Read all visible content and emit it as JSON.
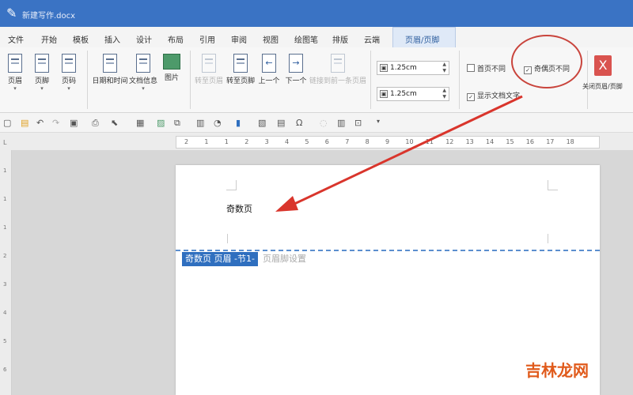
{
  "window": {
    "title": "新建写作.docx",
    "icon": "pen-icon"
  },
  "menu": {
    "items": [
      "文件",
      "开始",
      "模板",
      "插入",
      "设计",
      "布局",
      "引用",
      "审阅",
      "视图",
      "绘图笔",
      "排版",
      "云端",
      "页眉/页脚"
    ],
    "active": "页眉/页脚"
  },
  "ribbon": {
    "header": "页眉",
    "footer": "页脚",
    "page_number": "页码",
    "date_time": "日期和时间",
    "doc_info": "文档信息",
    "picture": "图片",
    "goto_header": "转至页眉",
    "goto_footer": "转至页脚",
    "prev": "上一个",
    "next": "下一个",
    "link_prev": "链接到前一条页眉",
    "header_distance": "1.25cm",
    "footer_distance": "1.25cm",
    "first_page_diff": "首页不同",
    "odd_even_diff": "奇偶页不同",
    "show_doc_text": "显示文档文字",
    "close": "关闭页眉/页脚",
    "close_glyph": "X"
  },
  "ruler": {
    "h_ticks": [
      "2",
      "1",
      "1",
      "2",
      "3",
      "4",
      "5",
      "6",
      "7",
      "8",
      "9",
      "10",
      "11",
      "12",
      "13",
      "14",
      "15",
      "16",
      "17",
      "18"
    ],
    "v_ticks": [
      "1",
      "1",
      "1",
      "2",
      "3",
      "4",
      "5",
      "6"
    ],
    "corner": "L"
  },
  "document": {
    "header_text": "奇数页",
    "header_label": "奇数页 页眉 -节1-",
    "header_setup": "页眉脚设置"
  },
  "watermark": "吉林龙网",
  "colors": {
    "title_bar": "#3a73c4",
    "accent": "#2f6fbf",
    "annotation": "#c9443c",
    "close": "#d9534f"
  }
}
